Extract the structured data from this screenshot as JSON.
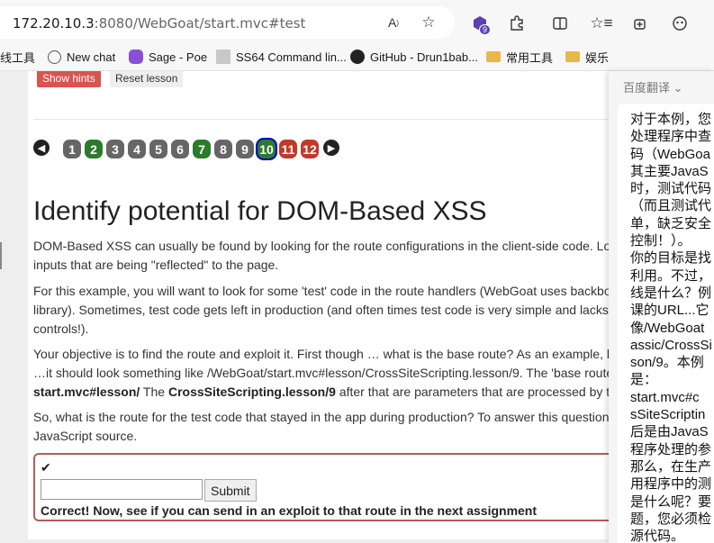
{
  "browser": {
    "url_host": "172.20.10.3",
    "url_path": ":8080/WebGoat/start.mvc#test",
    "extension_badge": "9",
    "icons": [
      "read-aloud-icon",
      "favorite-star-icon",
      "extension-icon",
      "puzzle-icon",
      "split-screen-icon",
      "favorites-icon",
      "collections-icon",
      "copilot-icon"
    ]
  },
  "bookmarks": [
    {
      "label": "线工具",
      "icon": "none"
    },
    {
      "label": "New chat",
      "icon": "openai-icon"
    },
    {
      "label": "Sage - Poe",
      "icon": "poe-icon"
    },
    {
      "label": "SS64 Command lin...",
      "icon": "ss64-icon"
    },
    {
      "label": "GitHub - Drun1bab...",
      "icon": "github-icon"
    },
    {
      "label": "常用工具",
      "icon": "folder-icon"
    },
    {
      "label": "娱乐",
      "icon": "folder-icon"
    }
  ],
  "lesson": {
    "show_hints": "Show hints",
    "reset_lesson": "Reset lesson",
    "steps": [
      {
        "n": "1",
        "state": "grey"
      },
      {
        "n": "2",
        "state": "green"
      },
      {
        "n": "3",
        "state": "grey"
      },
      {
        "n": "4",
        "state": "grey"
      },
      {
        "n": "5",
        "state": "grey"
      },
      {
        "n": "6",
        "state": "grey"
      },
      {
        "n": "7",
        "state": "green"
      },
      {
        "n": "8",
        "state": "grey"
      },
      {
        "n": "9",
        "state": "grey"
      },
      {
        "n": "10",
        "state": "current"
      },
      {
        "n": "11",
        "state": "red"
      },
      {
        "n": "12",
        "state": "red"
      }
    ],
    "title": "Identify potential for DOM-Based XSS",
    "p1": "DOM-Based XSS can usually be found by looking for the route configurations in the client-side code. Lo",
    "p1b": "inputs that are being \"reflected\" to the page.",
    "p2": "For this example, you will want to look for some 'test' code in the route handlers (WebGoat uses backbo",
    "p2b": "library). Sometimes, test code gets left in production (and often times test code is very simple and lacks",
    "p2c": "controls!).",
    "p3": "Your objective is to find the route and exploit it. First though … what is the base route? As an example, lo",
    "p3b": "…it should look something like /WebGoat/start.mvc#lesson/CrossSiteScripting.lesson/9. The 'base route",
    "p3c_bold1": "start.mvc#lesson/",
    "p3c_mid": " The ",
    "p3c_bold2": "CrossSiteScripting.lesson/9",
    "p3c_end": " after that are parameters that are processed by th",
    "p4": "So, what is the route for the test code that stayed in the app during production? To answer this question,",
    "p4b": "JavaScript source.",
    "answer_value": "",
    "submit": "Submit",
    "feedback": "Correct! Now, see if you can send in an exploit to that route in the next assignment"
  },
  "translate": {
    "title": "百度翻译",
    "lines": [
      "对于本例，您",
      "处理程序中查",
      "码（WebGoa",
      "其主要JavaS",
      "时，测试代码",
      "（而且测试代",
      "单，缺乏安全",
      "控制！）。",
      "你的目标是找",
      "利用。不过，",
      "线是什么？例",
      "课的URL...它",
      "像/WebGoat",
      "assic/CrossSi",
      "son/9。本例",
      "是：",
      "start.mvc#c",
      "sSiteScriptin",
      "后是由JavaS",
      "程序处理的参",
      "那么，在生产",
      "用程序中的测",
      "是什么呢？要",
      "题，您必须检",
      "源代码。"
    ]
  }
}
